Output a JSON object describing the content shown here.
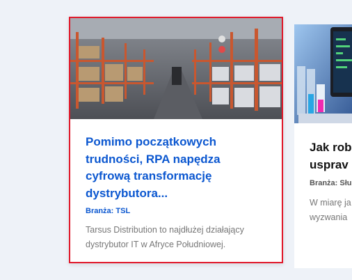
{
  "cards": [
    {
      "title": "Pomimo początkowych trudności, RPA napędza cyfrową transformację dystrybutora...",
      "branza": "Branża: TSL",
      "description": "Tarsus Distribution to najdłużej działający dystrybutor IT w Afryce Południowej.",
      "image_icon": "warehouse-photo"
    },
    {
      "title_line1": "Jak rob",
      "title_line2": "usprav",
      "branza": "Branża: Słu",
      "description_line1": "W miarę ja",
      "description_line2": "wyzwania",
      "image_icon": "laboratory-photo"
    }
  ],
  "colors": {
    "accent": "#0b57d0",
    "highlight_border": "#e0182a",
    "background": "#eef2f8"
  }
}
